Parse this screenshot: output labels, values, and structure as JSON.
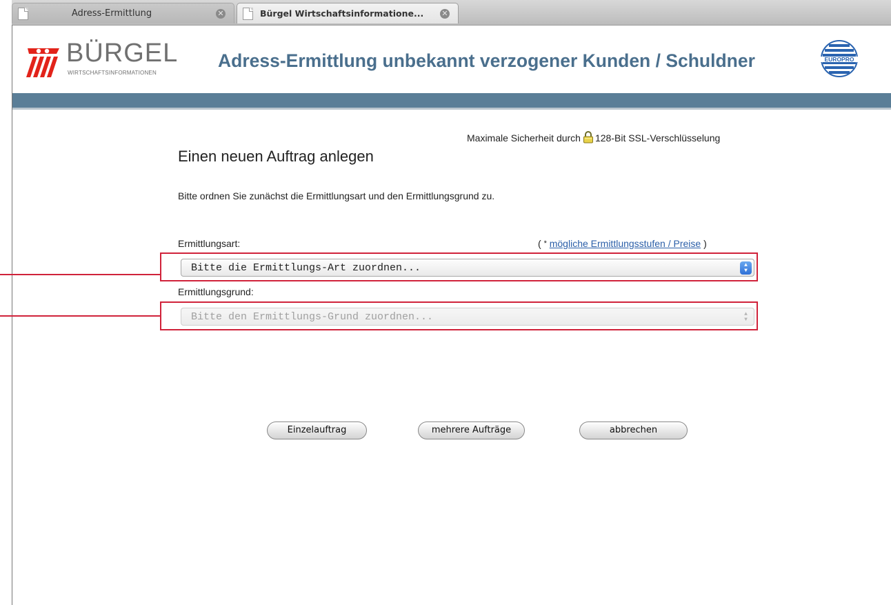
{
  "browser": {
    "tabs": [
      {
        "label": "Adress-Ermittlung",
        "active": false
      },
      {
        "label": "Bürgel Wirtschaftsinformatione...",
        "active": true
      }
    ]
  },
  "header": {
    "logo_text": "BÜRGEL",
    "logo_sub": "WIRTSCHAFTSINFORMATIONEN",
    "title": "Adress-Ermittlung unbekannt verzogener Kunden / Schuldner",
    "badge": "EUROPRO",
    "nav_color": "#5a7e97"
  },
  "main": {
    "security_prefix": "Maximale Sicherheit durch",
    "security_suffix": "128-Bit SSL-Verschlüsselung",
    "heading": "Einen neuen Auftrag anlegen",
    "intro": "Bitte ordnen Sie zunächst die Ermittlungsart und den Ermittlungsgrund zu.",
    "art_label": "Ermittlungsart:",
    "price_open": "(",
    "price_star": "*",
    "price_link": "mögliche Ermittlungsstufen / Preise",
    "price_close": ")",
    "art_select": "Bitte die Ermittlungs-Art zuordnen...",
    "grund_label": "Ermittlungsgrund:",
    "grund_select": "Bitte den Ermittlungs-Grund zuordnen...",
    "buttons": {
      "single": "Einzelauftrag",
      "multiple": "mehrere Aufträge",
      "cancel": "abbrechen"
    }
  },
  "colors": {
    "title": "#4a6f8d",
    "highlight": "#d0223a",
    "link": "#2a5ea8"
  }
}
